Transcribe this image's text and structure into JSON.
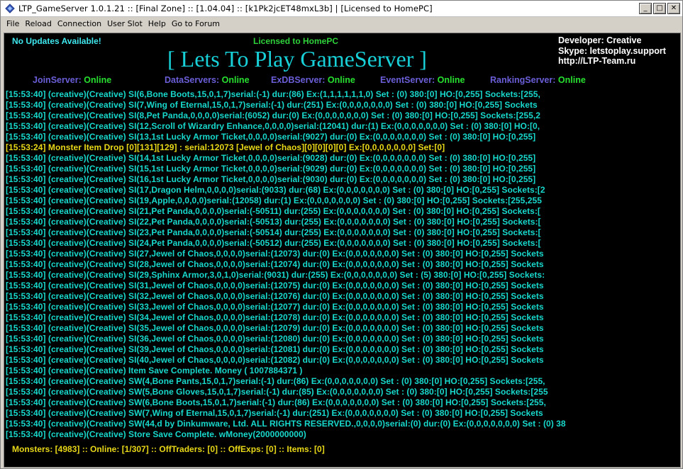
{
  "window": {
    "title": "LTP_GameServer 1.0.1.21 :: [Final Zone] :: [1.04.04] :: [k1Pk2jcET48mxL3b] | [Licensed to HomePC]",
    "controls": {
      "minimize": "_",
      "maximize": "□",
      "close": "✕"
    }
  },
  "menu": [
    "File",
    "Reload",
    "Connection",
    "User Slot",
    "Help",
    "Go to Forum"
  ],
  "header": {
    "updates": "No Updates Available!",
    "licensed": "Licensed to HomePC",
    "title": "[ Lets To Play GameServer ]",
    "developer": "Developer: Creative",
    "skype": "Skype: letstoplay.support",
    "site": "http://LTP-Team.ru"
  },
  "servers": [
    {
      "name": "JoinServer:",
      "status": "Online"
    },
    {
      "name": "DataServers:",
      "status": "Online"
    },
    {
      "name": "ExDBServer:",
      "status": "Online"
    },
    {
      "name": "EventServer:",
      "status": "Online"
    },
    {
      "name": "RankingServer:",
      "status": "Online"
    }
  ],
  "log": [
    "[15:53:40] (creative)(Creative) SI(6,Bone Boots,15,0,1,7)serial:(-1) dur:(86) Ex:(1,1,1,1,1,1,0) Set : (0) 380:[0] HO:[0,255] Sockets:[255,",
    "[15:53:40] (creative)(Creative) SI(7,Wing of Eternal,15,0,1,7)serial:(-1) dur:(251) Ex:(0,0,0,0,0,0,0) Set : (0) 380:[0] HO:[0,255] Sockets",
    "[15:53:40] (creative)(Creative) SI(8,Pet Panda,0,0,0,0)serial:(6052) dur:(0) Ex:(0,0,0,0,0,0,0) Set : (0) 380:[0] HO:[0,255] Sockets:[255,2",
    "[15:53:40] (creative)(Creative) SI(12,Scroll of Wizardry Enhance,0,0,0,0)serial:(12041) dur:(1) Ex:(0,0,0,0,0,0,0) Set : (0) 380:[0] HO:[0,",
    "[15:53:40] (creative)(Creative) SI(13,1st Lucky Armor Ticket,0,0,0,0)serial:(9027) dur:(0) Ex:(0,0,0,0,0,0,0) Set : (0) 380:[0] HO:[0,255]",
    "[15:53:24] Monster Item Drop [0][131][129] : serial:12073 [Jewel of Chaos][0][0][0][0] Ex:[0,0,0,0,0,0,0] Set:[0]",
    "[15:53:40] (creative)(Creative) SI(14,1st Lucky Armor Ticket,0,0,0,0)serial:(9028) dur:(0) Ex:(0,0,0,0,0,0,0) Set : (0) 380:[0] HO:[0,255]",
    "[15:53:40] (creative)(Creative) SI(15,1st Lucky Armor Ticket,0,0,0,0)serial:(9029) dur:(0) Ex:(0,0,0,0,0,0,0) Set : (0) 380:[0] HO:[0,255]",
    "[15:53:40] (creative)(Creative) SI(16,1st Lucky Armor Ticket,0,0,0,0)serial:(9030) dur:(0) Ex:(0,0,0,0,0,0,0) Set : (0) 380:[0] HO:[0,255]",
    "[15:53:40] (creative)(Creative) SI(17,Dragon Helm,0,0,0,0)serial:(9033) dur:(68) Ex:(0,0,0,0,0,0,0) Set : (0) 380:[0] HO:[0,255] Sockets:[2",
    "[15:53:40] (creative)(Creative) SI(19,Apple,0,0,0,0)serial:(12058) dur:(1) Ex:(0,0,0,0,0,0,0) Set : (0) 380:[0] HO:[0,255] Sockets:[255,255",
    "[15:53:40] (creative)(Creative) SI(21,Pet Panda,0,0,0,0)serial:(-50511) dur:(255) Ex:(0,0,0,0,0,0,0) Set : (0) 380:[0] HO:[0,255] Sockets:[",
    "[15:53:40] (creative)(Creative) SI(22,Pet Panda,0,0,0,0)serial:(-50513) dur:(255) Ex:(0,0,0,0,0,0,0) Set : (0) 380:[0] HO:[0,255] Sockets:[",
    "[15:53:40] (creative)(Creative) SI(23,Pet Panda,0,0,0,0)serial:(-50514) dur:(255) Ex:(0,0,0,0,0,0,0) Set : (0) 380:[0] HO:[0,255] Sockets:[",
    "[15:53:40] (creative)(Creative) SI(24,Pet Panda,0,0,0,0)serial:(-50512) dur:(255) Ex:(0,0,0,0,0,0,0) Set : (0) 380:[0] HO:[0,255] Sockets:[",
    "[15:53:40] (creative)(Creative) SI(27,Jewel of Chaos,0,0,0,0)serial:(12073) dur:(0) Ex:(0,0,0,0,0,0,0) Set : (0) 380:[0] HO:[0,255] Sockets",
    "[15:53:40] (creative)(Creative) SI(28,Jewel of Chaos,0,0,0,0)serial:(12074) dur:(0) Ex:(0,0,0,0,0,0,0) Set : (0) 380:[0] HO:[0,255] Sockets",
    "[15:53:40] (creative)(Creative) SI(29,Sphinx Armor,3,0,1,0)serial:(9031) dur:(255) Ex:(0,0,0,0,0,0,0) Set : (5) 380:[0] HO:[0,255] Sockets:",
    "[15:53:40] (creative)(Creative) SI(31,Jewel of Chaos,0,0,0,0)serial:(12075) dur:(0) Ex:(0,0,0,0,0,0,0) Set : (0) 380:[0] HO:[0,255] Sockets",
    "[15:53:40] (creative)(Creative) SI(32,Jewel of Chaos,0,0,0,0)serial:(12076) dur:(0) Ex:(0,0,0,0,0,0,0) Set : (0) 380:[0] HO:[0,255] Sockets",
    "[15:53:40] (creative)(Creative) SI(33,Jewel of Chaos,0,0,0,0)serial:(12077) dur:(0) Ex:(0,0,0,0,0,0,0) Set : (0) 380:[0] HO:[0,255] Sockets",
    "[15:53:40] (creative)(Creative) SI(34,Jewel of Chaos,0,0,0,0)serial:(12078) dur:(0) Ex:(0,0,0,0,0,0,0) Set : (0) 380:[0] HO:[0,255] Sockets",
    "[15:53:40] (creative)(Creative) SI(35,Jewel of Chaos,0,0,0,0)serial:(12079) dur:(0) Ex:(0,0,0,0,0,0,0) Set : (0) 380:[0] HO:[0,255] Sockets",
    "[15:53:40] (creative)(Creative) SI(36,Jewel of Chaos,0,0,0,0)serial:(12080) dur:(0) Ex:(0,0,0,0,0,0,0) Set : (0) 380:[0] HO:[0,255] Sockets",
    "[15:53:40] (creative)(Creative) SI(39,Jewel of Chaos,0,0,0,0)serial:(12081) dur:(0) Ex:(0,0,0,0,0,0,0) Set : (0) 380:[0] HO:[0,255] Sockets",
    "[15:53:40] (creative)(Creative) SI(40,Jewel of Chaos,0,0,0,0)serial:(12082) dur:(0) Ex:(0,0,0,0,0,0,0) Set : (0) 380:[0] HO:[0,255] Sockets",
    "[15:53:40] (creative)(Creative) Item Save Complete. Money ( 1007884371 )",
    "[15:53:40] (creative)(Creative) SW(4,Bone Pants,15,0,1,7)serial:(-1) dur:(86) Ex:(0,0,0,0,0,0,0) Set : (0) 380:[0] HO:[0,255] Sockets:[255,",
    "[15:53:40] (creative)(Creative) SW(5,Bone Gloves,15,0,1,7)serial:(-1) dur:(85) Ex:(0,0,0,0,0,0,0) Set : (0) 380:[0] HO:[0,255] Sockets:[255",
    "[15:53:40] (creative)(Creative) SW(6,Bone Boots,15,0,1,7)serial:(-1) dur:(86) Ex:(0,0,0,0,0,0,0) Set : (0) 380:[0] HO:[0,255] Sockets:[255,",
    "[15:53:40] (creative)(Creative) SW(7,Wing of Eternal,15,0,1,7)serial:(-1) dur:(251) Ex:(0,0,0,0,0,0,0) Set : (0) 380:[0] HO:[0,255] Sockets",
    "[15:53:40] (creative)(Creative) SW(44,d by Dinkumware, Ltd. ALL RIGHTS RESERVED.,0,0,0,0)serial:(0) dur:(0) Ex:(0,0,0,0,0,0,0) Set : (0) 38",
    "[15:53:40] (creative)(Creative) Store Save Complete. wMoney(2000000000)"
  ],
  "log_highlight_index": 5,
  "status": "Monsters: [4983] :: Online: [1/307] :: OffTraders: [0] :: OffExps: [0] :: Items: [0]",
  "colors": {
    "log_text": "#18d8cc",
    "highlight_text": "#e8d818",
    "server_name": "#6a5fd8",
    "server_online": "#28e030",
    "title": "#18d0d8"
  }
}
